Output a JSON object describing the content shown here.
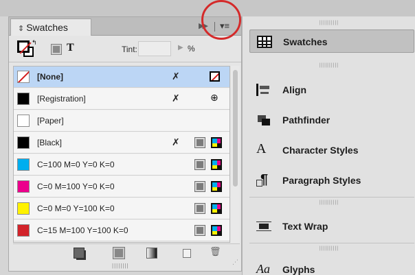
{
  "swatches_panel": {
    "tab_label": "Swatches",
    "tint_label": "Tint:",
    "tint_value": "",
    "percent": "%",
    "menu_glyph": "▾≡",
    "double_arrow": "▶▶",
    "swatches": [
      {
        "name": "[None]",
        "color": "none",
        "selected": true
      },
      {
        "name": "[Registration]",
        "color": "#000000"
      },
      {
        "name": "[Paper]",
        "color": "#ffffff"
      },
      {
        "name": "[Black]",
        "color": "#000000"
      },
      {
        "name": "C=100 M=0 Y=0 K=0",
        "color": "#00aeef"
      },
      {
        "name": "C=0 M=100 Y=0 K=0",
        "color": "#ec008c"
      },
      {
        "name": "C=0 M=0 Y=100 K=0",
        "color": "#fff200"
      },
      {
        "name": "C=15 M=100 Y=100 K=0",
        "color": "#d2232a"
      }
    ]
  },
  "dock": {
    "items": [
      {
        "label": "Swatches",
        "icon": "swatches-grid-icon",
        "active": true
      },
      {
        "label": "Align",
        "icon": "align-icon"
      },
      {
        "label": "Pathfinder",
        "icon": "pathfinder-icon"
      },
      {
        "label": "Character Styles",
        "icon": "character-styles-icon"
      },
      {
        "label": "Paragraph Styles",
        "icon": "paragraph-styles-icon"
      },
      {
        "label": "Text Wrap",
        "icon": "text-wrap-icon"
      },
      {
        "label": "Glyphs",
        "icon": "glyphs-icon",
        "icon_text": "Aa"
      }
    ]
  },
  "colors": {
    "selection": "#bcd6f5",
    "callout": "#d42a2a"
  }
}
